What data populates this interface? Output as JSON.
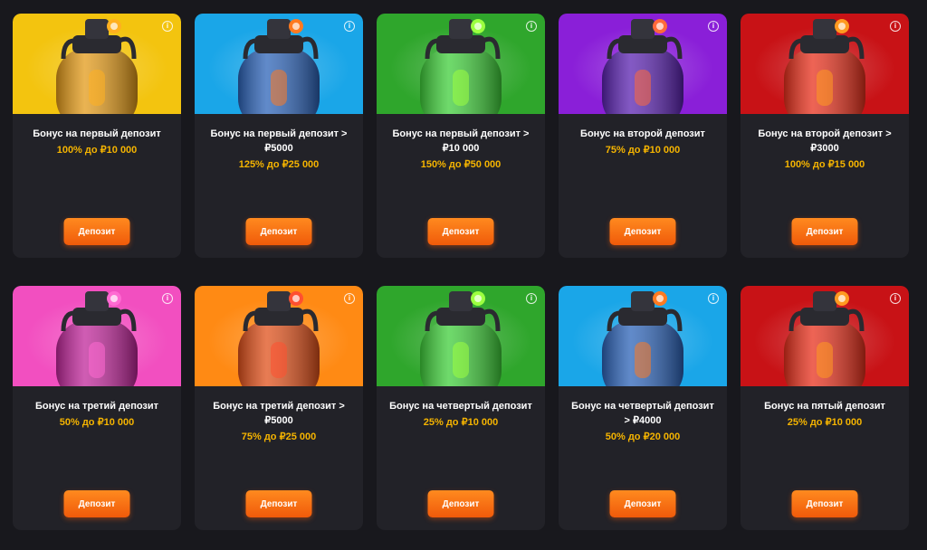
{
  "cards": [
    {
      "title": "Бонус на первый депозит",
      "amount": "100% до ₽10 000",
      "button": "Депозит",
      "bg": "#f3c40f",
      "body": "#e39a18",
      "accent": "#ffb020"
    },
    {
      "title": "Бонус на первый депозит > ₽5000",
      "amount": "125% до ₽25 000",
      "button": "Депозит",
      "bg": "#1aa6e8",
      "body": "#2c63b8",
      "accent": "#ff7a20"
    },
    {
      "title": "Бонус на первый депозит > ₽10 000",
      "amount": "150% до ₽50 000",
      "button": "Депозит",
      "bg": "#2fa62c",
      "body": "#3fce3a",
      "accent": "#9cff40"
    },
    {
      "title": "Бонус на второй депозит",
      "amount": "75% до ₽10 000",
      "button": "Депозит",
      "bg": "#8a1fd8",
      "body": "#5a22b0",
      "accent": "#ff6a3a"
    },
    {
      "title": "Бонус на второй депозит > ₽3000",
      "amount": "100% до ₽15 000",
      "button": "Депозит",
      "bg": "#c81216",
      "body": "#e8301c",
      "accent": "#ff9a20"
    },
    {
      "title": "Бонус на третий депозит",
      "amount": "50% до ₽10 000",
      "button": "Депозит",
      "bg": "#f24fc0",
      "body": "#c0269a",
      "accent": "#ff6ad2"
    },
    {
      "title": "Бонус на третий депозит > ₽5000",
      "amount": "75% до ₽25 000",
      "button": "Депозит",
      "bg": "#ff8a14",
      "body": "#e0501a",
      "accent": "#ff5030"
    },
    {
      "title": "Бонус на четвертый депозит",
      "amount": "25% до ₽10 000",
      "button": "Депозит",
      "bg": "#2fa62c",
      "body": "#3fce3a",
      "accent": "#9cff40"
    },
    {
      "title": "Бонус на четвертый депозит > ₽4000",
      "amount": "50% до ₽20 000",
      "button": "Депозит",
      "bg": "#1aa6e8",
      "body": "#2c63b8",
      "accent": "#ff7a20"
    },
    {
      "title": "Бонус на пятый депозит",
      "amount": "25% до ₽10 000",
      "button": "Депозит",
      "bg": "#c81216",
      "body": "#e8301c",
      "accent": "#ff9a20"
    }
  ]
}
